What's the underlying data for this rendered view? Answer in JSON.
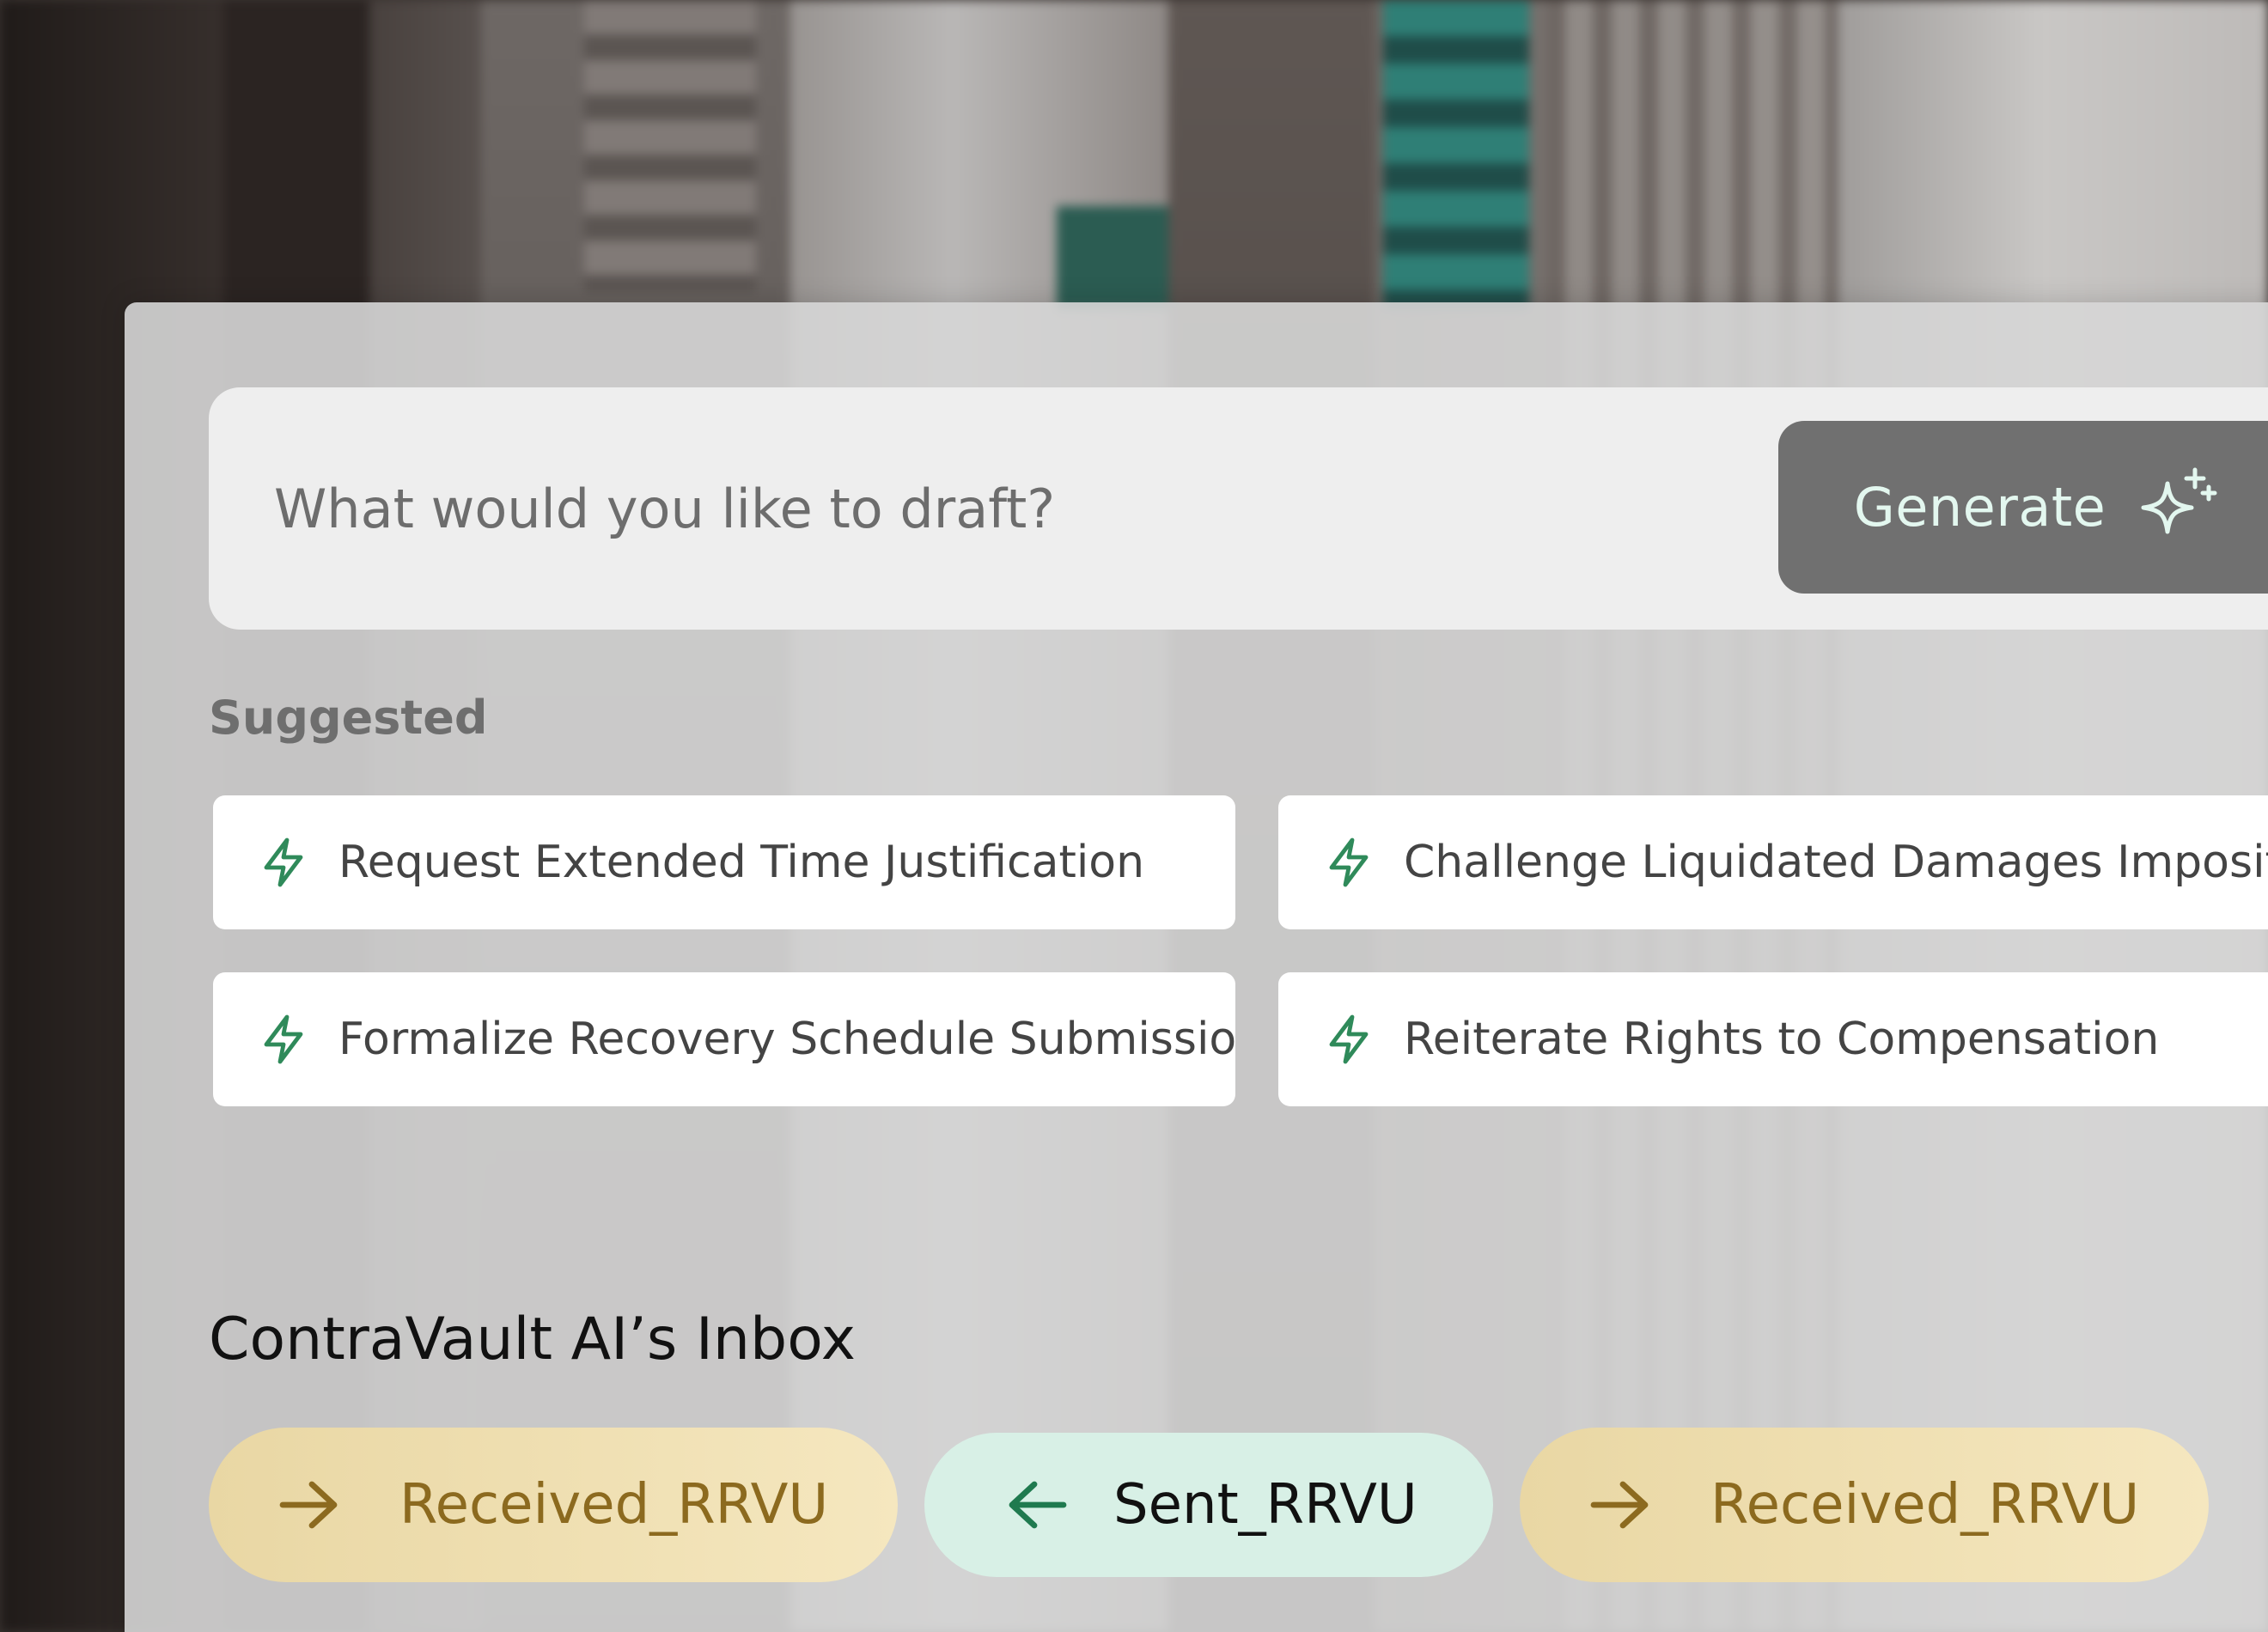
{
  "prompt": {
    "placeholder": "What would you like to draft?",
    "generate_label": "Generate"
  },
  "suggested": {
    "heading": "Suggested",
    "items": [
      {
        "label": "Request Extended Time Justification",
        "icon": "bolt-icon"
      },
      {
        "label": "Challenge Liquidated Damages Imposition",
        "icon": "bolt-icon"
      },
      {
        "label": "Formalize Recovery Schedule Submission",
        "icon": "bolt-icon"
      },
      {
        "label": "Reiterate Rights to Compensation",
        "icon": "bolt-icon"
      }
    ]
  },
  "inbox": {
    "title": "ContraVault AI’s Inbox",
    "items": [
      {
        "label": "Received_RRVU",
        "direction": "received",
        "icon": "arrow-right-icon"
      },
      {
        "label": "Sent_RRVU",
        "direction": "sent",
        "icon": "arrow-left-icon"
      },
      {
        "label": "Received_RRVU",
        "direction": "received",
        "icon": "arrow-right-icon"
      }
    ]
  },
  "colors": {
    "accent_green": "#2f8a5a",
    "received_text": "#8c6a1f",
    "received_bg": "#f0e0b4",
    "sent_bg": "#d8f0e6",
    "generate_bg": "#707070",
    "generate_text": "#e3f7ef"
  }
}
